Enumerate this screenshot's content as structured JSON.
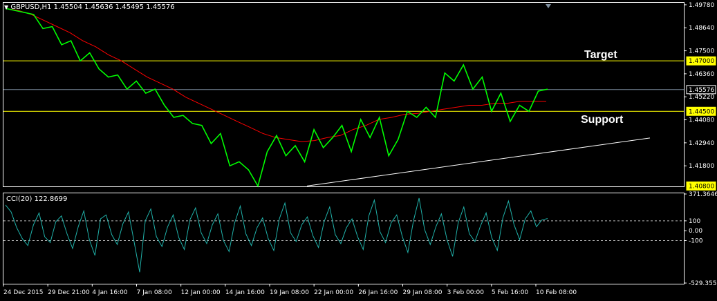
{
  "header": {
    "symbol": "GBPUSD,H1",
    "ohlc": "1.45504 1.45636 1.45495 1.45576",
    "collapse_icon": "triangle-down-icon"
  },
  "indicator": {
    "label": "CCI(20) 122.8699"
  },
  "annotations": {
    "target": "Target",
    "support": "Support"
  },
  "colors": {
    "price": "#00ff00",
    "ma": "#ff0000",
    "cci": "#20b2aa",
    "level": "#ffff00",
    "current": "#778899",
    "trendline": "#ffffff",
    "frame": "#ffffff"
  },
  "chart_data": [
    {
      "type": "line",
      "title": "GBPUSD,H1",
      "x_ticks": [
        "24 Dec 2015",
        "29 Dec 21:00",
        "4 Jan 16:00",
        "7 Jan 08:00",
        "12 Jan 00:00",
        "14 Jan 16:00",
        "19 Jan 08:00",
        "22 Jan 00:00",
        "26 Jan 16:00",
        "29 Jan 08:00",
        "3 Feb 00:00",
        "5 Feb 16:00",
        "10 Feb 08:00"
      ],
      "y_ticks": [
        "1.49780",
        "1.48640",
        "1.47500",
        "1.46360",
        "1.45220",
        "1.44080",
        "1.42940",
        "1.41800"
      ],
      "ylim": [
        1.4078,
        1.4988
      ],
      "price_labels": [
        "1.47000",
        "1.45576",
        "1.44500",
        "1.40800"
      ],
      "series": [
        {
          "values": [
            1.496,
            1.495,
            1.494,
            1.493,
            1.486,
            1.487,
            1.478,
            1.48,
            1.47,
            1.474,
            1.466,
            1.462,
            1.463,
            1.456,
            1.46,
            1.454,
            1.456,
            1.448,
            1.442,
            1.443,
            1.439,
            1.438,
            1.429,
            1.434,
            1.418,
            1.42,
            1.416,
            1.408,
            1.425,
            1.433,
            1.423,
            1.428,
            1.42,
            1.436,
            1.427,
            1.432,
            1.438,
            1.425,
            1.441,
            1.432,
            1.442,
            1.423,
            1.431,
            1.445,
            1.442,
            1.447,
            1.442,
            1.464,
            1.46,
            1.468,
            1.456,
            1.462,
            1.445,
            1.454,
            1.44,
            1.448,
            1.445,
            1.455,
            1.456
          ]
        },
        {
          "values": [
            1.496,
            1.495,
            1.493,
            1.49,
            1.487,
            1.484,
            1.48,
            1.477,
            1.473,
            1.47,
            1.466,
            1.462,
            1.459,
            1.456,
            1.452,
            1.449,
            1.446,
            1.443,
            1.44,
            1.437,
            1.434,
            1.432,
            1.431,
            1.43,
            1.4305,
            1.432,
            1.433,
            1.436,
            1.438,
            1.441,
            1.442,
            1.4435,
            1.444,
            1.445,
            1.446,
            1.447,
            1.448,
            1.448,
            1.449,
            1.449,
            1.45,
            1.45,
            1.45
          ]
        }
      ],
      "levels": [
        1.47,
        1.45576,
        1.445
      ],
      "trendline": {
        "x": [
          "19 Jan 08:00",
          "11 Feb"
        ],
        "y": [
          1.408,
          1.4318
        ]
      }
    },
    {
      "type": "line",
      "title": "CCI(20) 122.8699",
      "y_ticks": [
        "371.3646",
        "100",
        "0.00",
        "-100",
        "-529.3555"
      ],
      "ylim": [
        -529.3555,
        371.3646
      ],
      "levels": [
        100,
        -100
      ],
      "series": [
        {
          "values": [
            260,
            190,
            30,
            -80,
            -150,
            60,
            180,
            -60,
            -120,
            90,
            150,
            -30,
            -180,
            40,
            200,
            -90,
            -250,
            120,
            160,
            -40,
            -140,
            70,
            190,
            -110,
            -420,
            100,
            220,
            -60,
            -160,
            40,
            160,
            -70,
            -190,
            110,
            230,
            -20,
            -130,
            60,
            170,
            -100,
            -210,
            80,
            250,
            -30,
            -150,
            30,
            130,
            -80,
            -200,
            120,
            280,
            -20,
            -110,
            60,
            140,
            -50,
            -170,
            90,
            240,
            -40,
            -130,
            30,
            120,
            -60,
            -190,
            150,
            310,
            -10,
            -120,
            80,
            160,
            -60,
            -220,
            100,
            330,
            10,
            -140,
            40,
            170,
            -90,
            -260,
            80,
            240,
            -30,
            -110,
            50,
            180,
            -70,
            -200,
            130,
            300,
            60,
            -90,
            120,
            200,
            40,
            110,
            122.87
          ]
        }
      ]
    }
  ]
}
